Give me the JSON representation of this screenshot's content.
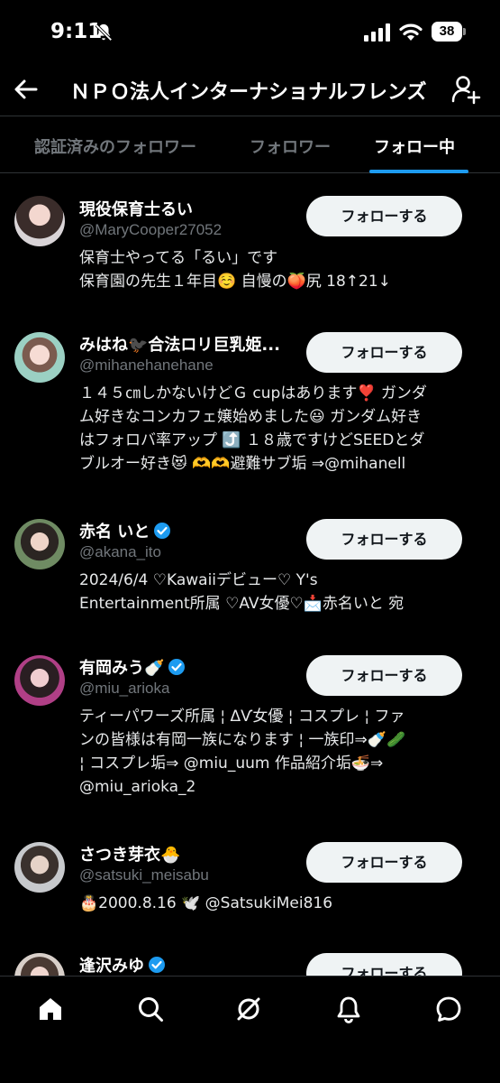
{
  "status_bar": {
    "time": "9:11",
    "battery": "38"
  },
  "header": {
    "title": "ＮＰＯ法人インターナショナルフレンズ"
  },
  "tabs": [
    {
      "label": "認証済みのフォロワー"
    },
    {
      "label": "フォロワー"
    },
    {
      "label": "フォロー中"
    }
  ],
  "users": [
    {
      "name": "現役保育士るい",
      "handle": "@MaryCooper27052",
      "verified": false,
      "button": "フォローする",
      "bio": [
        "保育士やってる「るい」です",
        "保育園の先生１年目☺️ 自慢の🍑尻 18↑21↓"
      ]
    },
    {
      "name": "みはね🐦‍⬛合法ロリ巨乳姫...",
      "handle": "@mihanehanehane",
      "verified": false,
      "button": "フォローする",
      "bio": [
        "１４５㎝しかないけどＧ cupはあります❣️ ガンダ",
        "ム好きなコンカフェ嬢始めました😃 ガンダム好き",
        "はフォロバ率アップ ⤴️ １８歳ですけどSEEDとダ",
        "ブルオー好き😻 🫶🫶避難サブ垢 ⇒@mihanell"
      ]
    },
    {
      "name": "赤名 いと",
      "handle": "@akana_ito",
      "verified": true,
      "button": "フォローする",
      "bio": [
        "2024/6/4 ♡Kawaiiデビュー♡ Y's",
        "Entertainment所属 ♡AV女優♡📩赤名いと 宛"
      ]
    },
    {
      "name": "有岡みう🍼",
      "handle": "@miu_arioka",
      "verified": true,
      "button": "フォローする",
      "bio": [
        "ティーパワーズ所属 ¦ ΔѴ女優 ¦ コスプレ ¦ ファ",
        "ンの皆様は有岡一族になります ¦ 一族印⇒🍼🥒",
        "¦ コスプレ垢⇒ @miu_uum 作品紹介垢🍜⇒",
        "@miu_arioka_2"
      ]
    },
    {
      "name": "さつき芽衣🐣",
      "handle": "@satsuki_meisabu",
      "verified": false,
      "button": "フォローする",
      "bio": [
        "🎂2000.8.16 🕊️ @SatsukiMei816"
      ]
    },
    {
      "name": "逢沢みゆ",
      "handle": "",
      "verified": true,
      "button": "フォローする",
      "bio": []
    }
  ],
  "colors": {
    "accent": "#1d9bf0",
    "background": "#000000",
    "button_bg": "#eff3f4",
    "muted": "#71767b"
  },
  "bottom_nav": [
    {
      "icon": "home-icon"
    },
    {
      "icon": "search-icon"
    },
    {
      "icon": "grok-icon"
    },
    {
      "icon": "notifications-icon"
    },
    {
      "icon": "messages-icon"
    }
  ]
}
